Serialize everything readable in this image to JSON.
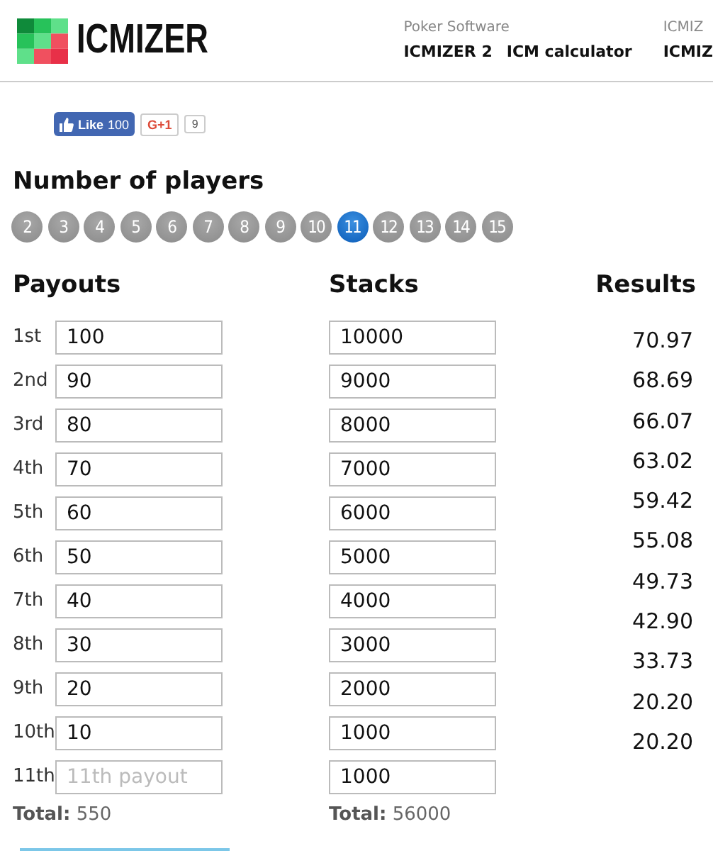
{
  "header": {
    "logo": "ICMIZER",
    "nav_caption": "Poker Software",
    "nav_links": [
      "ICMIZER 2",
      "ICM calculator"
    ],
    "nav_caption_2": "ICMIZ",
    "nav_link_cut": "ICMIZ"
  },
  "social": {
    "like_label": "Like",
    "like_count": "100",
    "gplus_label": "G+1",
    "gplus_count": "9"
  },
  "players": {
    "title": "Number of players",
    "options": [
      {
        "label": "2",
        "selected": false
      },
      {
        "label": "3",
        "selected": false
      },
      {
        "label": "4",
        "selected": false
      },
      {
        "label": "5",
        "selected": false
      },
      {
        "label": "6",
        "selected": false
      },
      {
        "label": "7",
        "selected": false
      },
      {
        "label": "8",
        "selected": false
      },
      {
        "label": "9",
        "selected": false
      },
      {
        "label": "10",
        "selected": false
      },
      {
        "label": "11",
        "selected": true
      },
      {
        "label": "12",
        "selected": false
      },
      {
        "label": "13",
        "selected": false
      },
      {
        "label": "14",
        "selected": false
      },
      {
        "label": "15",
        "selected": false
      }
    ]
  },
  "payouts": {
    "title": "Payouts",
    "rows": [
      {
        "place": "1st",
        "value": "100"
      },
      {
        "place": "2nd",
        "value": "90"
      },
      {
        "place": "3rd",
        "value": "80"
      },
      {
        "place": "4th",
        "value": "70"
      },
      {
        "place": "5th",
        "value": "60"
      },
      {
        "place": "6th",
        "value": "50"
      },
      {
        "place": "7th",
        "value": "40"
      },
      {
        "place": "8th",
        "value": "30"
      },
      {
        "place": "9th",
        "value": "20"
      },
      {
        "place": "10th",
        "value": "10"
      },
      {
        "place": "11th",
        "placeholder": "11th payout"
      }
    ],
    "total_label": "Total:",
    "total": "550"
  },
  "stacks": {
    "title": "Stacks",
    "values": [
      "10000",
      "9000",
      "8000",
      "7000",
      "6000",
      "5000",
      "4000",
      "3000",
      "2000",
      "1000",
      "1000"
    ],
    "total_label": "Total:",
    "total": "56000"
  },
  "results": {
    "title": "Results",
    "values": [
      "70.97",
      "68.69",
      "66.07",
      "63.02",
      "59.42",
      "55.08",
      "49.73",
      "42.90",
      "33.73",
      "20.20",
      "20.20"
    ]
  }
}
